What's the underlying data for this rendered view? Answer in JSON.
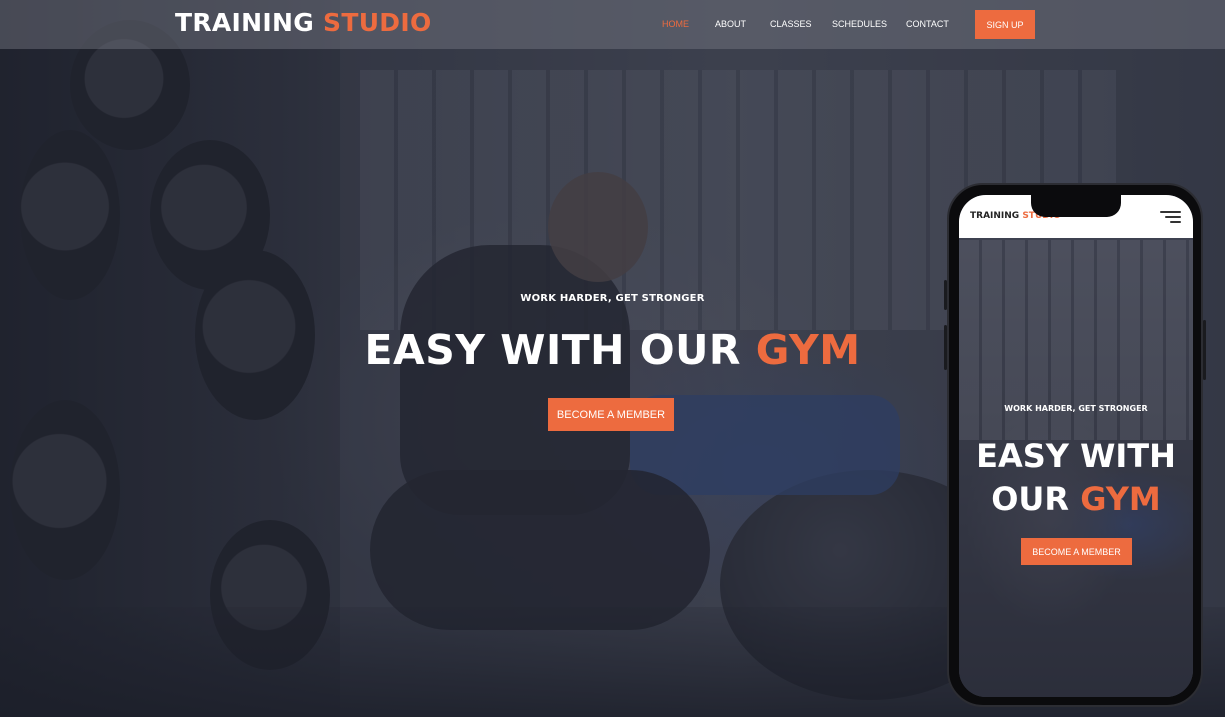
{
  "header": {
    "logo_main": "TRAINING",
    "logo_accent": "STUDIO",
    "nav": [
      {
        "label": "HOME",
        "active": true
      },
      {
        "label": "ABOUT",
        "active": false
      },
      {
        "label": "CLASSES",
        "active": false
      },
      {
        "label": "SCHEDULES",
        "active": false
      },
      {
        "label": "CONTACT",
        "active": false
      }
    ],
    "signup_label": "SIGN UP"
  },
  "hero": {
    "kicker": "WORK HARDER, GET STRONGER",
    "headline_main": "EASY WITH OUR",
    "headline_accent": "GYM",
    "cta_label": "BECOME A MEMBER"
  },
  "mobile": {
    "logo_main": "TRAINING",
    "logo_accent": "STUDIO",
    "kicker": "WORK HARDER, GET STRONGER",
    "headline_line1": "EASY WITH",
    "headline_line2_main": "OUR",
    "headline_line2_accent": "GYM",
    "cta_label": "BECOME A MEMBER",
    "menu_icon": "hamburger-menu-icon"
  },
  "colors": {
    "accent": "#ed6b3f",
    "text": "#ffffff"
  }
}
